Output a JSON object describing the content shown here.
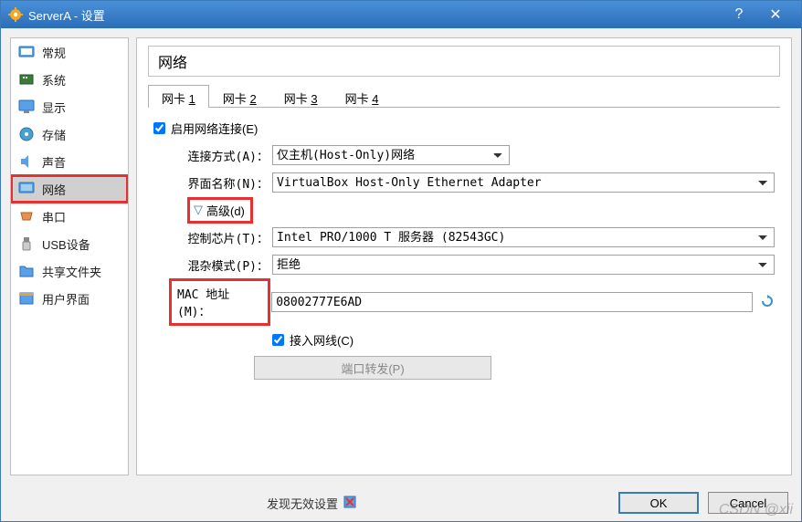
{
  "title": "ServerA - 设置",
  "sidebar": {
    "items": [
      {
        "label": "常规"
      },
      {
        "label": "系统"
      },
      {
        "label": "显示"
      },
      {
        "label": "存储"
      },
      {
        "label": "声音"
      },
      {
        "label": "网络"
      },
      {
        "label": "串口"
      },
      {
        "label": "USB设备"
      },
      {
        "label": "共享文件夹"
      },
      {
        "label": "用户界面"
      }
    ],
    "active_index": 5
  },
  "panel": {
    "title": "网络"
  },
  "tabs": [
    {
      "label": "网卡 ",
      "num": "1"
    },
    {
      "label": "网卡 ",
      "num": "2"
    },
    {
      "label": "网卡 ",
      "num": "3"
    },
    {
      "label": "网卡 ",
      "num": "4"
    }
  ],
  "active_tab": 0,
  "form": {
    "enable_label": "启用网络连接(E)",
    "enable_checked": true,
    "attach_label": "连接方式(A)：",
    "attach_value": "仅主机(Host-Only)网络",
    "iface_label": "界面名称(N)：",
    "iface_value": "VirtualBox Host-Only Ethernet Adapter",
    "advanced_label": "高级(d)",
    "chip_label": "控制芯片(T)：",
    "chip_value": "Intel PRO/1000 T 服务器 (82543GC)",
    "promisc_label": "混杂模式(P)：",
    "promisc_value": "拒绝",
    "mac_label": "MAC 地址(M)：",
    "mac_value": "08002777E6AD",
    "cable_label": "接入网线(C)",
    "cable_checked": true,
    "portfwd_label": "端口转发(P)"
  },
  "footer": {
    "status": "发现无效设置",
    "ok": "OK",
    "cancel": "Cancel"
  },
  "watermark": "CSDN @xii"
}
